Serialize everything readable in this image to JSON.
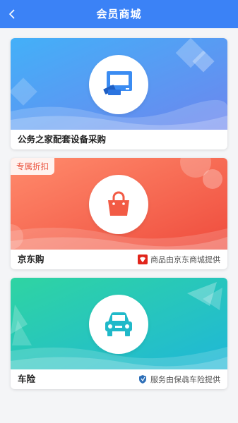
{
  "header": {
    "title": "会员商城",
    "back_icon": "chevron-left-icon"
  },
  "cards": [
    {
      "name": "公务之家配套设备采购",
      "icon": "computer-monitor-icon",
      "gradient": [
        "#4aa3f6",
        "#6a8ff0"
      ]
    },
    {
      "name": "京东购",
      "badge": "专属折扣",
      "provider": "商品由京东商城提供",
      "icon": "shopping-bag-icon",
      "provider_icon": "jd-logo-icon",
      "gradient": [
        "#ff8a6b",
        "#f1503f"
      ]
    },
    {
      "name": "车险",
      "provider": "服务由保骉车险提供",
      "icon": "car-icon",
      "provider_icon": "shield-logo-icon",
      "gradient": [
        "#2fd1a8",
        "#22b9d6"
      ]
    }
  ],
  "colors": {
    "header": "#3b82f6",
    "card1_icon": "#3b8cf2",
    "card2_icon": "#f25b45",
    "card3_icon": "#20b9c9"
  }
}
